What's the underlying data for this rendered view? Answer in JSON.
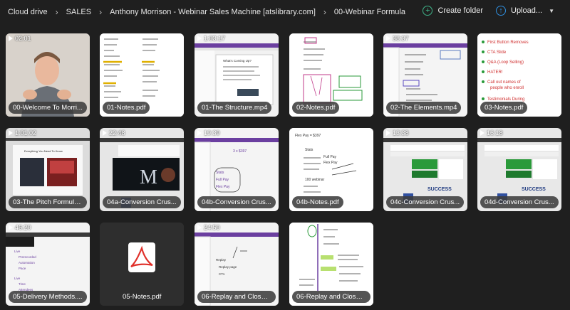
{
  "breadcrumbs": [
    "Cloud drive",
    "SALES",
    "Anthony Morrison - Webinar Sales Machine [atslibrary.com]",
    "00-Webinar Formula"
  ],
  "toolbar": {
    "create_folder": "Create folder",
    "upload": "Upload..."
  },
  "files": [
    {
      "name": "00-Welcome To Morri...",
      "duration": "02:01",
      "kind": "video"
    },
    {
      "name": "01-Notes.pdf",
      "duration": null,
      "kind": "pdf"
    },
    {
      "name": "01-The Structure.mp4",
      "duration": "1:03:17",
      "kind": "video"
    },
    {
      "name": "02-Notes.pdf",
      "duration": null,
      "kind": "pdf"
    },
    {
      "name": "02-The Elements.mp4",
      "duration": "38:37",
      "kind": "video"
    },
    {
      "name": "03-Notes.pdf",
      "duration": null,
      "kind": "pdf"
    },
    {
      "name": "03-The Pitch Formula...",
      "duration": "1:01:02",
      "kind": "video"
    },
    {
      "name": "04a-Conversion Crus...",
      "duration": "22:48",
      "kind": "video"
    },
    {
      "name": "04b-Conversion Crus...",
      "duration": "19:39",
      "kind": "video"
    },
    {
      "name": "04b-Notes.pdf",
      "duration": null,
      "kind": "pdf"
    },
    {
      "name": "04c-Conversion Crus...",
      "duration": "13:38",
      "kind": "video"
    },
    {
      "name": "04d-Conversion Crus...",
      "duration": "16:18",
      "kind": "video"
    },
    {
      "name": "05-Delivery Methods....",
      "duration": "46:20",
      "kind": "video"
    },
    {
      "name": "05-Notes.pdf",
      "duration": null,
      "kind": "pdf-icon"
    },
    {
      "name": "06-Replay and Close....",
      "duration": "24:50",
      "kind": "video"
    },
    {
      "name": "06-Replay and Close....",
      "duration": null,
      "kind": "pdf"
    }
  ],
  "thumb_text": {
    "n01": [
      "Training",
      "Funnel 200",
      "Webinar",
      "Deal List",
      "Live Webinar",
      "Grow Rewards",
      "Training",
      "Hooks"
    ],
    "n03": [
      "First Button Removes",
      "CTA Slide",
      "Q&A (Loop Selling)",
      "HATER!",
      "Call out names of",
      "people who enroll",
      "Testimonials During"
    ],
    "n04b": [
      "Flex Pay = $397",
      "Stats",
      "Full Pay",
      "Flex Pay",
      "100 webinar"
    ],
    "v01": [
      "What's Coming Up?"
    ],
    "v03": [
      "Everything You Need To Know",
      "To Build A Business"
    ],
    "v04b": [
      "3 x $397",
      "Full Pay",
      "Flex Pay",
      "Stats"
    ],
    "v05": [
      "Live",
      "Prerecorded",
      "Automation",
      "Pace",
      "Live",
      "Time",
      "Attendees"
    ],
    "v06": [
      "Replay",
      "Replay page",
      "CTA"
    ],
    "brand": [
      "SUCCESS"
    ],
    "logo": [
      "A",
      "M"
    ]
  }
}
